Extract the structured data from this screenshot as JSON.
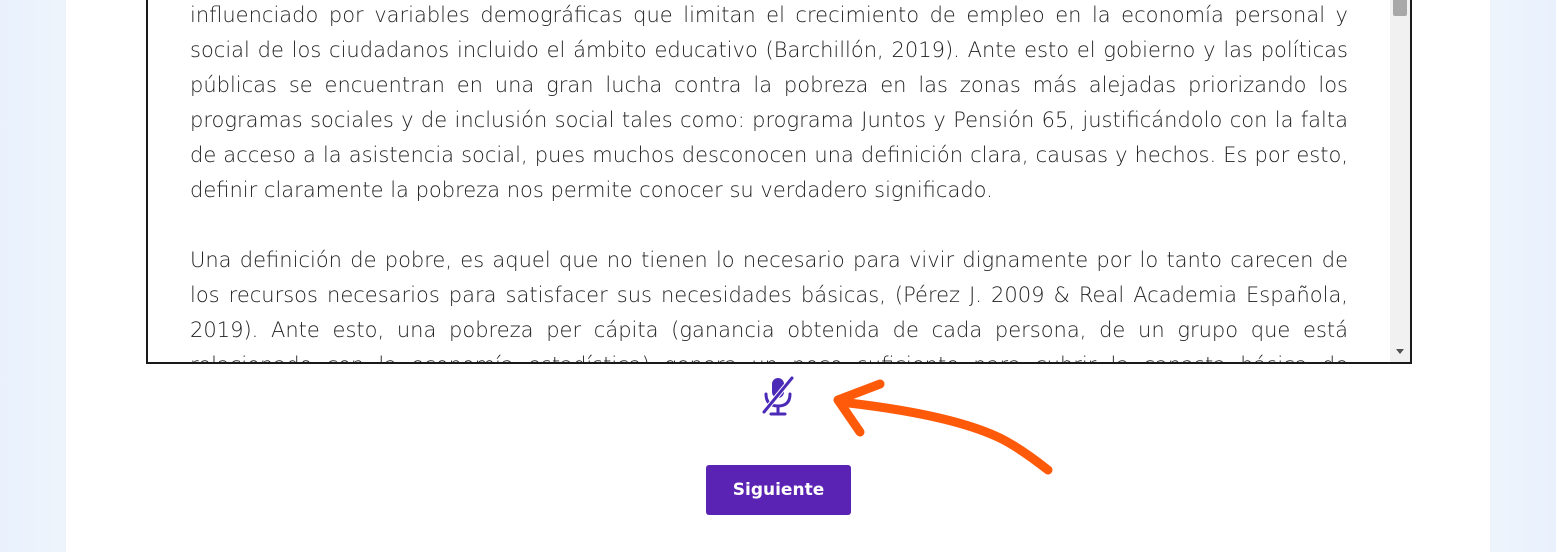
{
  "reading": {
    "paragraphs": [
      "influenciado por variables demográficas que limitan el crecimiento de empleo en la economía personal y social de los ciudadanos incluido el ámbito educativo (Barchillón, 2019). Ante esto el gobierno y las políticas públicas se encuentran en una gran lucha contra la pobreza en las zonas más alejadas priorizando los programas sociales y de inclusión social tales como: programa Juntos y Pensión 65, justificándolo con la falta de acceso a la asistencia social, pues muchos desconocen una definición clara, causas y hechos. Es por esto, definir claramente la pobreza nos permite conocer su verdadero significado.",
      "Una definición de pobre, es aquel que no tienen lo necesario para vivir dignamente por lo tanto carecen de los recursos necesarios para satisfacer sus necesidades básicas, (Pérez J. 2009 & Real Academia Española, 2019). Ante esto, una pobreza per cápita (ganancia obtenida de cada persona, de un grupo que está relacionado con la economía estadística) genera un poco suficiente para cubrir la canasta básica de alimentos y bienes."
    ]
  },
  "controls": {
    "mic_icon": "microphone-muted-icon",
    "next_label": "Siguiente"
  },
  "colors": {
    "accent": "#5b23b3",
    "annotation": "#ff5a0a",
    "mic": "#4b2ab8"
  }
}
